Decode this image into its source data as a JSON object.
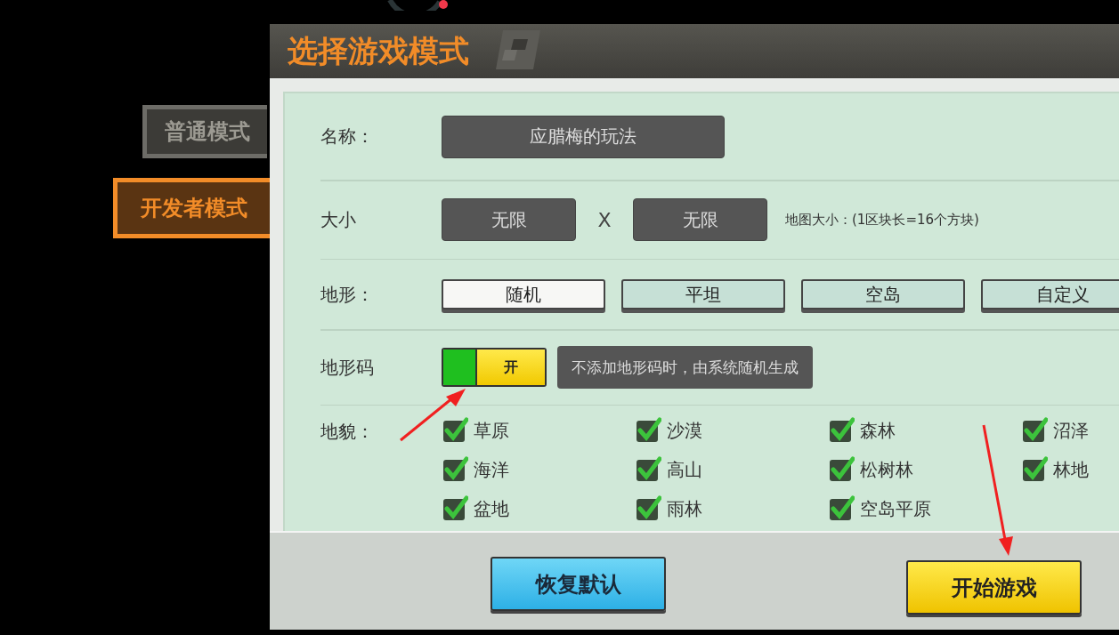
{
  "title": "选择游戏模式",
  "modes": [
    {
      "label": "普通模式",
      "selected": false
    },
    {
      "label": "开发者模式",
      "selected": true
    }
  ],
  "form": {
    "name": {
      "label": "名称：",
      "value": "应腊梅的玩法"
    },
    "size": {
      "label": "大小",
      "width": "无限",
      "separator": "X",
      "height": "无限",
      "hint": "地图大小：(1区块长=16个方块)"
    },
    "terrain": {
      "label": "地形：",
      "options": [
        {
          "label": "随机",
          "selected": true
        },
        {
          "label": "平坦",
          "selected": false
        },
        {
          "label": "空岛",
          "selected": false
        },
        {
          "label": "自定义",
          "selected": false
        }
      ]
    },
    "terrain_code": {
      "label": "地形码",
      "on": true,
      "toggle_label": "开",
      "hint": "不添加地形码时，由系统随机生成"
    },
    "biomes": {
      "label": "地貌：",
      "items": [
        {
          "label": "草原",
          "checked": true
        },
        {
          "label": "沙漠",
          "checked": true
        },
        {
          "label": "森林",
          "checked": true
        },
        {
          "label": "沼泽",
          "checked": true
        },
        {
          "label": "海洋",
          "checked": true
        },
        {
          "label": "高山",
          "checked": true
        },
        {
          "label": "松树林",
          "checked": true
        },
        {
          "label": "林地",
          "checked": true
        },
        {
          "label": "盆地",
          "checked": true
        },
        {
          "label": "雨林",
          "checked": true
        },
        {
          "label": "空岛平原",
          "checked": true
        }
      ]
    }
  },
  "buttons": [
    {
      "label": "恢复默认",
      "kind": "reset"
    },
    {
      "label": "开始游戏",
      "kind": "start"
    }
  ]
}
